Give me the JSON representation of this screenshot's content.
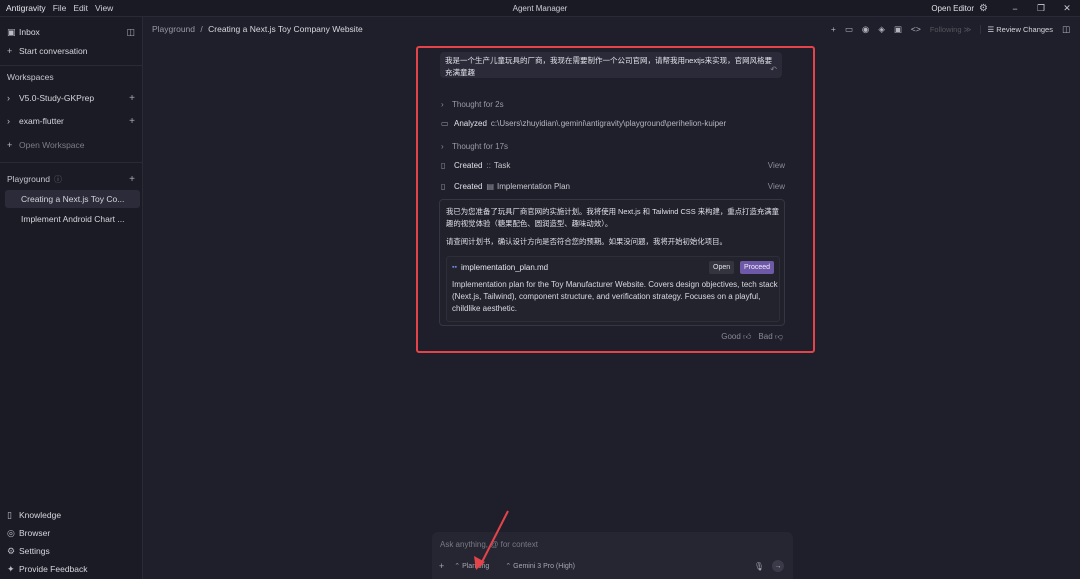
{
  "titlebar": {
    "menu": [
      "Antigravity",
      "File",
      "Edit",
      "View"
    ],
    "title": "Agent Manager",
    "open_editor": "Open Editor"
  },
  "sidebar": {
    "inbox": "Inbox",
    "start_conversation": "Start conversation",
    "workspaces_header": "Workspaces",
    "workspaces": [
      "V5.0-Study-GKPrep",
      "exam-flutter"
    ],
    "open_workspace": "Open Workspace",
    "playground_header": "Playground",
    "playground_items": [
      "Creating a Next.js Toy Co...",
      "Implement Android Chart ..."
    ],
    "bottom": [
      "Knowledge",
      "Browser",
      "Settings",
      "Provide Feedback"
    ]
  },
  "breadcrumb": {
    "root": "Playground",
    "separator": "/",
    "current": "Creating a Next.js Toy Company Website"
  },
  "toolbar": {
    "following": "Following",
    "review_changes": "Review Changes"
  },
  "conversation": {
    "user_message": "我是一个生产儿童玩具的厂商，我现在需要制作一个公司官网，请帮我用nextjs来实现，官网风格要充满童趣",
    "thought1": "Thought for 2s",
    "analyzed_label": "Analyzed",
    "analyzed_path": "c:\\Users\\zhuyidian\\.gemini\\antigravity\\playground\\perihelion-kuiper",
    "thought2": "Thought for 17s",
    "created_label": "Created",
    "created_task_icon": "::",
    "created_task": "Task",
    "created_plan": "Implementation Plan",
    "view": "View",
    "response_p1": "我已为您准备了玩具厂商官网的实施计划。我将使用 Next.js 和 Tailwind CSS 来构建，重点打造充满童趣的视觉体验（糖果配色、圆润造型、趣味动效）。",
    "response_p2": "请查阅计划书，确认设计方向是否符合您的预期。如果没问题，我将开始初始化项目。",
    "file_name": "implementation_plan.md",
    "open_btn": "Open",
    "proceed_btn": "Proceed",
    "file_desc": "Implementation plan for the Toy Manufacturer Website. Covers design objectives, tech stack (Next.js, Tailwind), component structure, and verification strategy. Focuses on a playful, childlike aesthetic.",
    "good": "Good",
    "bad": "Bad"
  },
  "composer": {
    "placeholder": "Ask anything, @ for context",
    "mode": "Planning",
    "model": "Gemini 3 Pro (High)"
  },
  "colors": {
    "highlight": "#e4434a",
    "proceed": "#6e58a8",
    "background": "#1f1f2b"
  }
}
